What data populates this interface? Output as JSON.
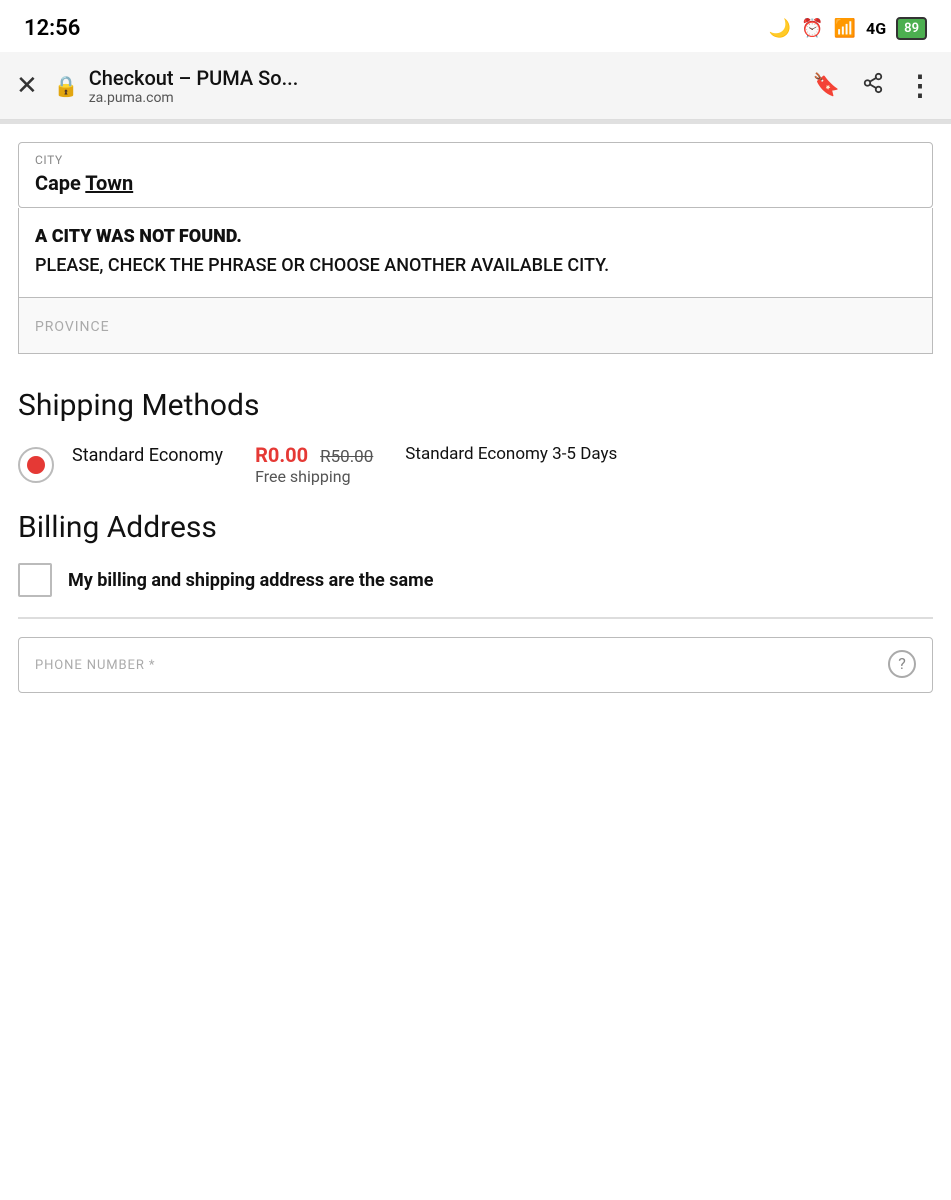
{
  "statusBar": {
    "time": "12:56",
    "icons": {
      "moon": "🌙",
      "alarm": "⏰",
      "signal": "📶",
      "network": "4G",
      "battery": "89"
    }
  },
  "browser": {
    "closeIcon": "✕",
    "lockIcon": "🔒",
    "pageTitle": "Checkout – PUMA So...",
    "url": "za.puma.com",
    "bookmarkIcon": "🔖",
    "shareIcon": "⬆",
    "moreIcon": "⋮"
  },
  "form": {
    "cityLabel": "CITY",
    "cityValue": "Cape",
    "cityValueUnderline": "Town",
    "errorTitle": "A CITY WAS NOT FOUND.",
    "errorMessage": "PLEASE, CHECK THE PHRASE OR CHOOSE ANOTHER AVAILABLE CITY.",
    "provinceLabel": "PROVINCE"
  },
  "shippingMethods": {
    "sectionTitle": "Shipping Methods",
    "methods": [
      {
        "name": "Standard Economy",
        "priceNew": "R0.00",
        "priceOld": "R50.00",
        "freeLabel": "Free shipping",
        "description": "Standard Economy 3-5 Days",
        "selected": true
      }
    ]
  },
  "billingAddress": {
    "sectionTitle": "Billing Address",
    "checkboxLabel": "My billing and shipping address are the same"
  },
  "phoneField": {
    "label": "PHONE NUMBER *",
    "helpIcon": "?"
  }
}
